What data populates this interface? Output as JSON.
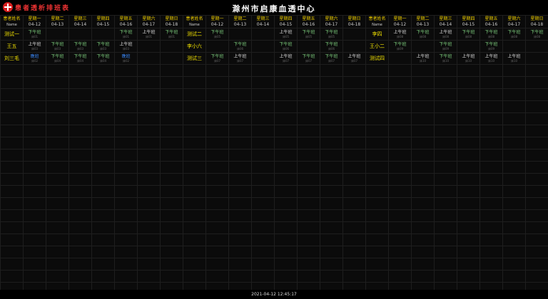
{
  "header": {
    "app_title": "患者透析排班表",
    "center_name": "滁州市启康血透中心"
  },
  "columns": {
    "name_label": "患者姓名",
    "name_sub": "Name",
    "days": [
      {
        "day": "星期一",
        "date": "04-12"
      },
      {
        "day": "星期二",
        "date": "04-13"
      },
      {
        "day": "星期三",
        "date": "04-14"
      },
      {
        "day": "星期四",
        "date": "04-15"
      },
      {
        "day": "星期五",
        "date": "04-16"
      },
      {
        "day": "星期六",
        "date": "04-17"
      },
      {
        "day": "星期日",
        "date": "04-18"
      }
    ]
  },
  "groups": [
    {
      "patients": [
        {
          "name": "测试一",
          "cells": [
            {
              "t": "下午班",
              "c": "pm",
              "s": "床01"
            },
            null,
            null,
            null,
            {
              "t": "下午班",
              "c": "pm",
              "s": "床01"
            },
            {
              "t": "上午班",
              "c": "am",
              "s": "床01"
            },
            {
              "t": "下午班",
              "c": "pm",
              "s": "床01"
            }
          ]
        },
        {
          "name": "王五",
          "cells": [
            {
              "t": "上午班",
              "c": "am",
              "s": "床03"
            },
            {
              "t": "下午班",
              "c": "pm",
              "s": "床03"
            },
            {
              "t": "下午班",
              "c": "pm",
              "s": "床03"
            },
            {
              "t": "下午班",
              "c": "pm",
              "s": "床03"
            },
            {
              "t": "上午班",
              "c": "am",
              "s": "床03"
            },
            null,
            null
          ]
        },
        {
          "name": "刘三毛",
          "cells": [
            {
              "t": "晚班",
              "c": "mid",
              "s": "床02"
            },
            {
              "t": "下午班",
              "c": "pm",
              "s": "床04"
            },
            {
              "t": "下午班",
              "c": "pm",
              "s": "床04"
            },
            {
              "t": "下午班",
              "c": "pm",
              "s": "床04"
            },
            {
              "t": "晚班",
              "c": "mid",
              "s": "床02"
            },
            null,
            null
          ]
        }
      ]
    },
    {
      "patients": [
        {
          "name": "测试二",
          "cells": [
            {
              "t": "下午班",
              "c": "pm",
              "s": "床05"
            },
            null,
            null,
            {
              "t": "上午班",
              "c": "am",
              "s": "床05"
            },
            {
              "t": "下午班",
              "c": "pm",
              "s": "床05"
            },
            {
              "t": "下午班",
              "c": "pm",
              "s": "床05"
            },
            null
          ]
        },
        {
          "name": "李小六",
          "cells": [
            null,
            {
              "t": "下午班",
              "c": "pm",
              "s": "床06"
            },
            null,
            {
              "t": "下午班",
              "c": "pm",
              "s": "床06"
            },
            null,
            {
              "t": "下午班",
              "c": "pm",
              "s": "床06"
            },
            null
          ]
        },
        {
          "name": "测试三",
          "cells": [
            {
              "t": "下午班",
              "c": "pm",
              "s": "床07"
            },
            {
              "t": "上午班",
              "c": "am",
              "s": "床07"
            },
            null,
            {
              "t": "上午班",
              "c": "am",
              "s": "床07"
            },
            {
              "t": "下午班",
              "c": "pm",
              "s": "床07"
            },
            {
              "t": "下午班",
              "c": "pm",
              "s": "床07"
            },
            {
              "t": "上午班",
              "c": "am",
              "s": "床07"
            }
          ]
        }
      ]
    },
    {
      "patients": [
        {
          "name": "李四",
          "cells": [
            {
              "t": "上午班",
              "c": "am",
              "s": "床08"
            },
            {
              "t": "下午班",
              "c": "pm",
              "s": "床08"
            },
            {
              "t": "上午班",
              "c": "am",
              "s": "床08"
            },
            {
              "t": "下午班",
              "c": "pm",
              "s": "床08"
            },
            {
              "t": "下午班",
              "c": "pm",
              "s": "床08"
            },
            {
              "t": "下午班",
              "c": "pm",
              "s": "床08"
            },
            {
              "t": "下午班",
              "c": "pm",
              "s": "床08"
            }
          ]
        },
        {
          "name": "王小二",
          "cells": [
            {
              "t": "下午班",
              "c": "pm",
              "s": "床09"
            },
            null,
            {
              "t": "下午班",
              "c": "pm",
              "s": "床09"
            },
            null,
            {
              "t": "下午班",
              "c": "pm",
              "s": "床09"
            },
            null,
            null
          ]
        },
        {
          "name": "测试四",
          "cells": [
            null,
            {
              "t": "上午班",
              "c": "am",
              "s": "床10"
            },
            {
              "t": "下午班",
              "c": "pm",
              "s": "床10"
            },
            {
              "t": "上午班",
              "c": "am",
              "s": "床10"
            },
            {
              "t": "上午班",
              "c": "am",
              "s": "床10"
            },
            {
              "t": "上午班",
              "c": "am",
              "s": "床10"
            },
            null
          ]
        }
      ]
    }
  ],
  "footer": {
    "timestamp": "2021-04-12 12:45:17"
  }
}
